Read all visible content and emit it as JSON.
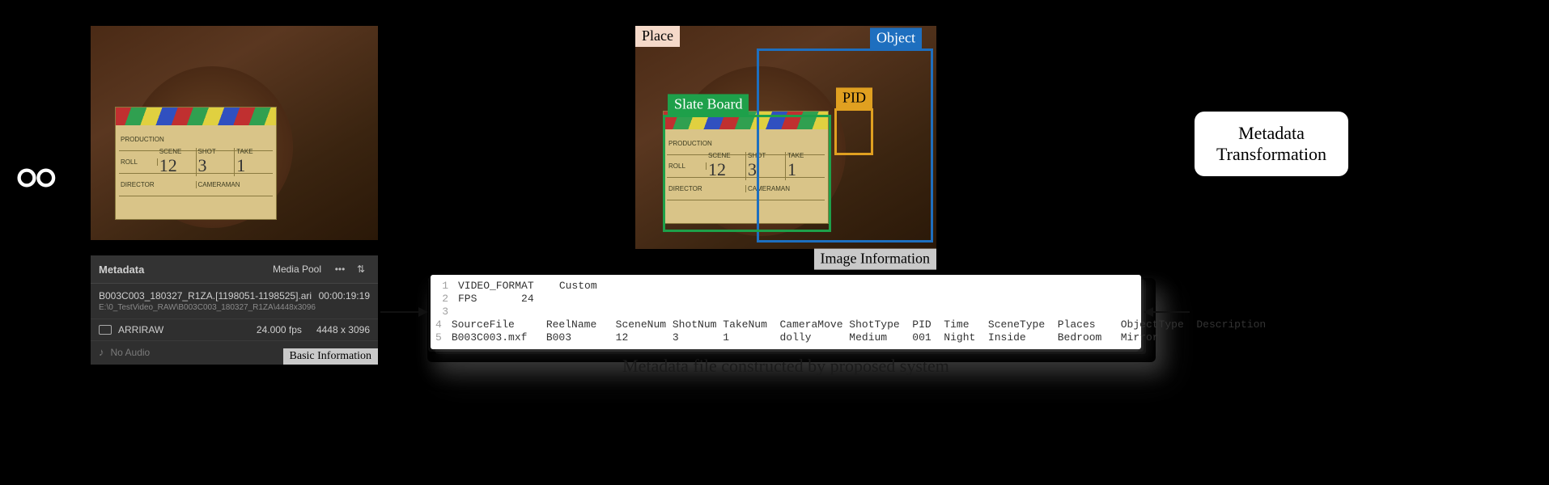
{
  "labels": {
    "basic_info": "Basic Information",
    "image_info": "Image Information",
    "place": "Place",
    "object": "Object",
    "slate_board": "Slate Board",
    "pid": "PID",
    "meta_transform": "Metadata\nTransformation",
    "metafile_caption": "Metadata file constructed by proposed system"
  },
  "slate": {
    "production": "PRODUCTION",
    "roll": "ROLL",
    "scene": "SCENE",
    "shot": "SHOT",
    "take": "TAKE",
    "scene_val": "12",
    "shot_val": "3",
    "take_val": "1",
    "director": "DIRECTOR",
    "cameraman": "CAMERAMAN"
  },
  "metadata_panel": {
    "title": "Metadata",
    "pool": "Media Pool",
    "filename": "B003C003_180327_R1ZA.[1198051-1198525].ari",
    "duration": "00:00:19:19",
    "path": "E:\\0_TestVideo_RAW\\B003C003_180327_R1ZA\\4448x3096",
    "codec": "ARRIRAW",
    "fps": "24.000 fps",
    "resolution": "4448 x 3096",
    "no_audio": "No Audio"
  },
  "metafile": {
    "lines": [
      "VIDEO_FORMAT    Custom",
      "FPS       24",
      "",
      "SourceFile     ReelName   SceneNum ShotNum TakeNum  CameraMove ShotType  PID  Time   SceneType  Places    ObjectType  Description",
      "B003C003.mxf   B003       12       3       1        dolly      Medium    001  Night  Inside     Bedroom   Mirror"
    ]
  },
  "chart_data": {
    "type": "table",
    "title": "Metadata file constructed by proposed system",
    "header_kv": {
      "VIDEO_FORMAT": "Custom",
      "FPS": 24
    },
    "columns": [
      "SourceFile",
      "ReelName",
      "SceneNum",
      "ShotNum",
      "TakeNum",
      "CameraMove",
      "ShotType",
      "PID",
      "Time",
      "SceneType",
      "Places",
      "ObjectType",
      "Description"
    ],
    "rows": [
      {
        "SourceFile": "B003C003.mxf",
        "ReelName": "B003",
        "SceneNum": 12,
        "ShotNum": 3,
        "TakeNum": 1,
        "CameraMove": "dolly",
        "ShotType": "Medium",
        "PID": "001",
        "Time": "Night",
        "SceneType": "Inside",
        "Places": "Bedroom",
        "ObjectType": "Mirror",
        "Description": ""
      }
    ]
  }
}
